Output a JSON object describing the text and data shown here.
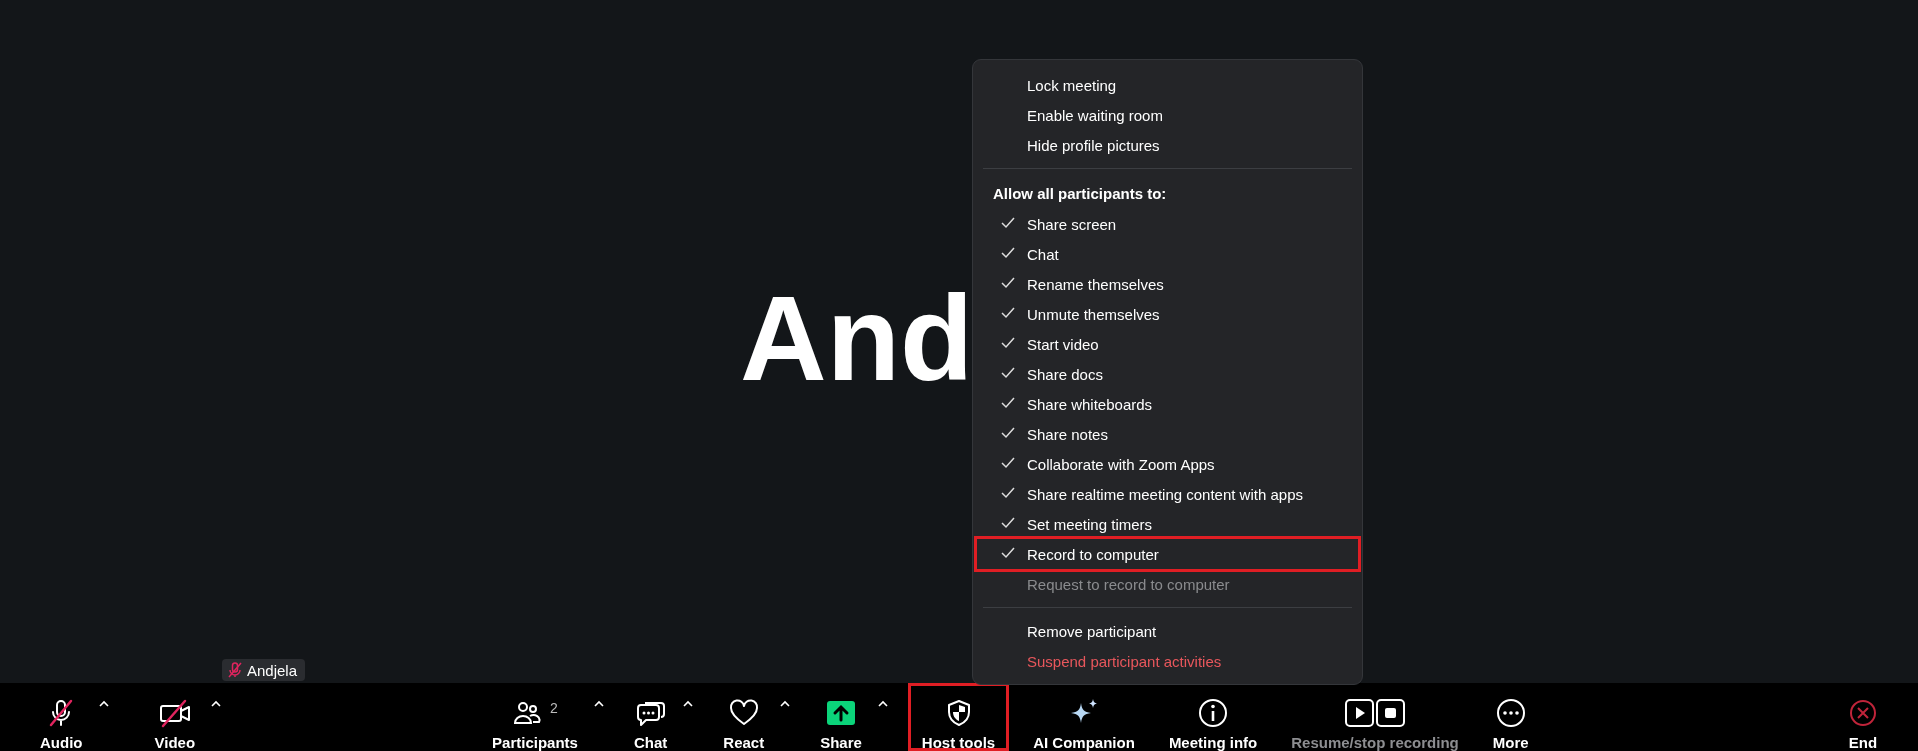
{
  "stage": {
    "participant_name": "And",
    "name_tag": {
      "label": "Andjela",
      "muted": true
    }
  },
  "host_menu": {
    "items": [
      {
        "kind": "action",
        "label": "Lock meeting"
      },
      {
        "kind": "action",
        "label": "Enable waiting room"
      },
      {
        "kind": "action",
        "label": "Hide profile pictures"
      },
      {
        "kind": "divider"
      },
      {
        "kind": "header",
        "label": "Allow all participants to:"
      },
      {
        "kind": "check",
        "label": "Share screen",
        "checked": true,
        "disabled": false,
        "highlighted": false
      },
      {
        "kind": "check",
        "label": "Chat",
        "checked": true,
        "disabled": false,
        "highlighted": false
      },
      {
        "kind": "check",
        "label": "Rename themselves",
        "checked": true,
        "disabled": false,
        "highlighted": false
      },
      {
        "kind": "check",
        "label": "Unmute themselves",
        "checked": true,
        "disabled": false,
        "highlighted": false
      },
      {
        "kind": "check",
        "label": "Start video",
        "checked": true,
        "disabled": false,
        "highlighted": false
      },
      {
        "kind": "check",
        "label": "Share docs",
        "checked": true,
        "disabled": false,
        "highlighted": false
      },
      {
        "kind": "check",
        "label": "Share whiteboards",
        "checked": true,
        "disabled": false,
        "highlighted": false
      },
      {
        "kind": "check",
        "label": "Share notes",
        "checked": true,
        "disabled": false,
        "highlighted": false
      },
      {
        "kind": "check",
        "label": "Collaborate with Zoom Apps",
        "checked": true,
        "disabled": false,
        "highlighted": false
      },
      {
        "kind": "check",
        "label": "Share realtime meeting content with apps",
        "checked": true,
        "disabled": false,
        "highlighted": false
      },
      {
        "kind": "check",
        "label": "Set meeting timers",
        "checked": true,
        "disabled": false,
        "highlighted": false
      },
      {
        "kind": "check",
        "label": "Record to computer",
        "checked": true,
        "disabled": false,
        "highlighted": true
      },
      {
        "kind": "check",
        "label": "Request to record to computer",
        "checked": false,
        "disabled": true,
        "highlighted": false
      },
      {
        "kind": "divider"
      },
      {
        "kind": "action",
        "label": "Remove participant"
      },
      {
        "kind": "danger",
        "label": "Suspend participant activities"
      }
    ]
  },
  "toolbar": {
    "left": [
      {
        "kind": "audio",
        "label": "Audio",
        "off": true,
        "caret": true,
        "highlighted": false,
        "disabled": false
      },
      {
        "kind": "video",
        "label": "Video",
        "off": true,
        "caret": true,
        "highlighted": false,
        "disabled": false
      }
    ],
    "center": [
      {
        "kind": "participants",
        "label": "Participants",
        "count": "2",
        "caret": true,
        "highlighted": false,
        "disabled": false
      },
      {
        "kind": "chat",
        "label": "Chat",
        "caret": true,
        "highlighted": false,
        "disabled": false
      },
      {
        "kind": "react",
        "label": "React",
        "caret": true,
        "highlighted": false,
        "disabled": false
      },
      {
        "kind": "share",
        "label": "Share",
        "caret": true,
        "highlighted": false,
        "disabled": false
      },
      {
        "kind": "host",
        "label": "Host tools",
        "caret": false,
        "highlighted": true,
        "disabled": false
      },
      {
        "kind": "ai",
        "label": "AI Companion",
        "caret": false,
        "highlighted": false,
        "disabled": false
      },
      {
        "kind": "info",
        "label": "Meeting info",
        "caret": false,
        "highlighted": false,
        "disabled": false
      },
      {
        "kind": "record",
        "label": "Resume/stop recording",
        "caret": false,
        "highlighted": false,
        "disabled": true
      },
      {
        "kind": "more",
        "label": "More",
        "caret": false,
        "highlighted": false,
        "disabled": false
      }
    ],
    "right": [
      {
        "kind": "end",
        "label": "End",
        "caret": false,
        "highlighted": false,
        "disabled": false
      }
    ]
  }
}
